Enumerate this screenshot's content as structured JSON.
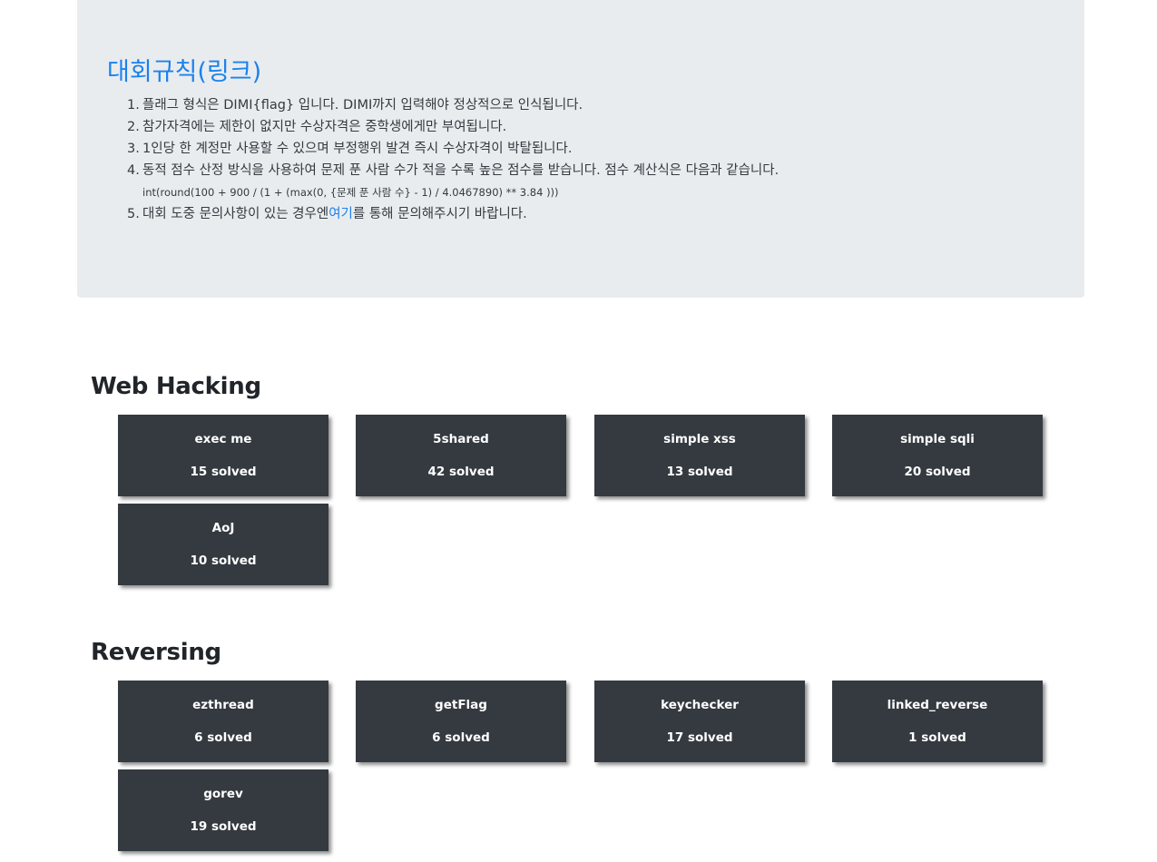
{
  "rules": {
    "title": "대회규칙(링크)",
    "items": [
      {
        "num": "1.",
        "text": "플래그 형식은 DIMI{flag} 입니다. DIMI까지 입력해야 정상적으로 인식됩니다."
      },
      {
        "num": "2.",
        "text": "참가자격에는 제한이 없지만 수상자격은 중학생에게만 부여됩니다."
      },
      {
        "num": "3.",
        "text": "1인당 한 계정만 사용할 수 있으며 부정행위 발견 즉시 수상자격이 박탈됩니다."
      },
      {
        "num": "4.",
        "text": "동적 점수 산정 방식을 사용하여 문제 푼 사람 수가 적을 수록 높은 점수를 받습니다. 점수 계산식은 다음과 같습니다."
      }
    ],
    "formula": "int(round(100 + 900 / (1 + (max(0, {문제 푼 사람 수} - 1) / 4.0467890) ** 3.84 )))",
    "item5": {
      "num": "5.",
      "before": "대회 도중 문의사항이 있는 경우엔",
      "link": "여기",
      "after": "를 통해 문의해주시기 바랍니다."
    }
  },
  "categories": [
    {
      "title": "Web Hacking",
      "challenges": [
        {
          "name": "exec me",
          "solved": "15 solved"
        },
        {
          "name": "5shared",
          "solved": "42 solved"
        },
        {
          "name": "simple xss",
          "solved": "13 solved"
        },
        {
          "name": "simple sqli",
          "solved": "20 solved"
        },
        {
          "name": "AoJ",
          "solved": "10 solved"
        }
      ]
    },
    {
      "title": "Reversing",
      "challenges": [
        {
          "name": "ezthread",
          "solved": "6 solved"
        },
        {
          "name": "getFlag",
          "solved": "6 solved"
        },
        {
          "name": "keychecker",
          "solved": "17 solved"
        },
        {
          "name": "linked_reverse",
          "solved": "1 solved"
        },
        {
          "name": "gorev",
          "solved": "19 solved"
        }
      ]
    }
  ]
}
